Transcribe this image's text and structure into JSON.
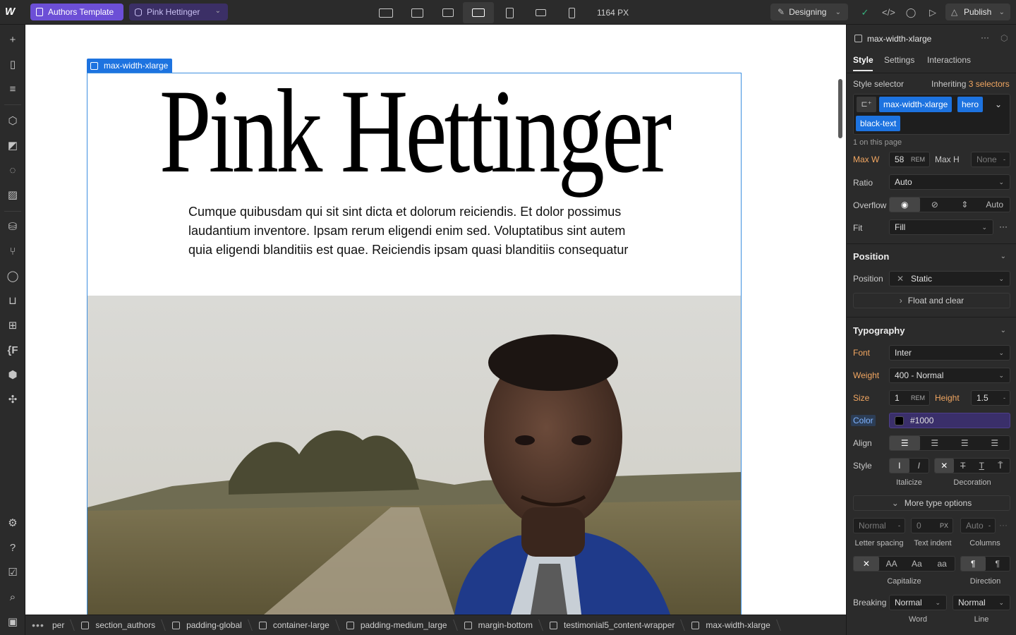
{
  "topbar": {
    "template_label": "Authors Template",
    "cms_item_label": "Pink Hettinger",
    "canvas_width": "1164 PX",
    "mode_label": "Designing",
    "publish_label": "Publish"
  },
  "canvas": {
    "selection_tag": "max-width-xlarge",
    "hero_title": "Pink Hettinger",
    "hero_text": "Cumque quibusdam qui sit sint dicta et dolorum reiciendis. Et dolor possimus laudantium inventore. Ipsam rerum eligendi enim sed. Voluptatibus sint autem quia eligendi blanditiis est quae. Reiciendis ipsam quasi blanditiis consequatur"
  },
  "breadcrumbs": [
    "per",
    "section_authors",
    "padding-global",
    "container-large",
    "padding-medium_large",
    "margin-bottom",
    "testimonial5_content-wrapper",
    "max-width-xlarge"
  ],
  "panel": {
    "element_name": "max-width-xlarge",
    "tabs": [
      "Style",
      "Settings",
      "Interactions"
    ],
    "selector_label": "Style selector",
    "inheriting_prefix": "Inheriting",
    "inheriting_count": "3 selectors",
    "chips": [
      "max-width-xlarge",
      "hero",
      "black-text"
    ],
    "on_page": "1 on this page",
    "size": {
      "maxw_label": "Max W",
      "maxw_value": "58",
      "maxw_unit": "REM",
      "maxh_label": "Max H",
      "maxh_value": "None",
      "ratio_label": "Ratio",
      "ratio_value": "Auto",
      "overflow_label": "Overflow",
      "overflow_auto": "Auto",
      "fit_label": "Fit",
      "fit_value": "Fill"
    },
    "position": {
      "title": "Position",
      "label": "Position",
      "value": "Static",
      "float_label": "Float and clear"
    },
    "typography": {
      "title": "Typography",
      "font_label": "Font",
      "font_value": "Inter",
      "weight_label": "Weight",
      "weight_value": "400 - Normal",
      "size_label": "Size",
      "size_value": "1",
      "size_unit": "REM",
      "height_label": "Height",
      "height_value": "1.5",
      "color_label": "Color",
      "color_value": "#1000",
      "align_label": "Align",
      "style_label": "Style",
      "italicize_label": "Italicize",
      "decoration_label": "Decoration",
      "more_label": "More type options",
      "letter_spacing_value": "Normal",
      "text_indent_value": "0",
      "text_indent_unit": "PX",
      "columns_value": "Auto",
      "letter_spacing_label": "Letter spacing",
      "text_indent_label": "Text indent",
      "columns_label": "Columns",
      "capitalize_options": [
        "AA",
        "Aa",
        "aa"
      ],
      "capitalize_label": "Capitalize",
      "direction_label": "Direction",
      "breaking_label": "Breaking",
      "word_value": "Normal",
      "line_value": "Normal",
      "word_label": "Word",
      "line_label": "Line"
    }
  }
}
